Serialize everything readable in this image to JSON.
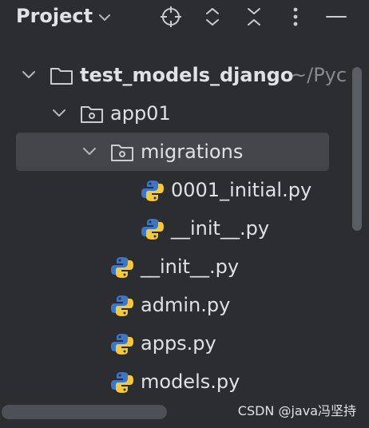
{
  "header": {
    "title": "Project",
    "icons": [
      "chevron-down-icon",
      "locate-icon",
      "expand-icon",
      "collapse-icon",
      "more-icon",
      "minimize-icon"
    ]
  },
  "tree": {
    "root": {
      "label": "test_models_django",
      "path_hint": "~/Pyc",
      "expanded": true
    },
    "app01": {
      "label": "app01",
      "expanded": true
    },
    "migrations": {
      "label": "migrations",
      "expanded": true,
      "selected": true
    },
    "files": [
      {
        "label": "0001_initial.py",
        "type": "python"
      },
      {
        "label": "__init__.py",
        "type": "python"
      },
      {
        "label": "__init__.py",
        "type": "python"
      },
      {
        "label": "admin.py",
        "type": "python"
      },
      {
        "label": "apps.py",
        "type": "python"
      },
      {
        "label": "models.py",
        "type": "python"
      }
    ]
  },
  "watermark": "CSDN @java冯坚持",
  "colors": {
    "background": "#2b2d30",
    "selection": "#43454a",
    "text": "#dfe1e5",
    "hint": "#868a91",
    "python_blue": "#3b77c9",
    "python_yellow": "#f5c93a"
  }
}
